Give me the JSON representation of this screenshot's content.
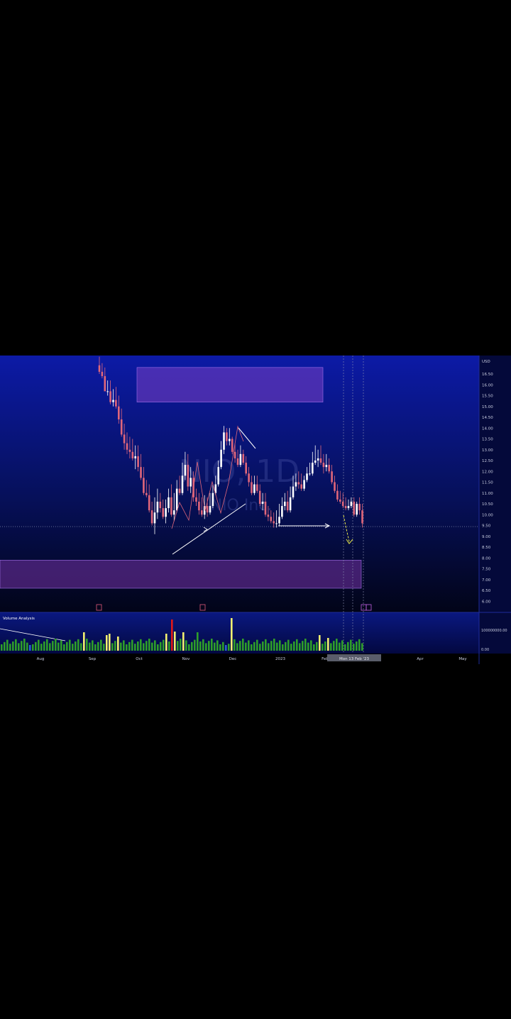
{
  "watermark": {
    "symbol": "NIO, 1D",
    "company": "NIO Inc."
  },
  "colors": {
    "bull": "#ffffff",
    "bear": "#e0667a",
    "zone": "#7b3fc4",
    "vol_green": "#2e9e2a",
    "vol_yellow": "#f3f070",
    "vol_red": "#e01818",
    "vol_blue": "#2a62d6",
    "annotation": "#ffffff",
    "projection": "#e8e84a"
  },
  "price_axis": {
    "currency": "USD",
    "ticks": [
      "16.50",
      "16.00",
      "15.50",
      "15.00",
      "14.50",
      "14.00",
      "13.50",
      "13.00",
      "12.50",
      "12.00",
      "11.50",
      "11.00",
      "10.50",
      "10.00",
      "9.50",
      "9.00",
      "8.50",
      "8.00",
      "7.50",
      "7.00",
      "6.50",
      "6.00"
    ]
  },
  "volume_axis": {
    "ticks": [
      "100000000.00",
      "0.00"
    ]
  },
  "volume_pane": {
    "title": "Volume Analysis"
  },
  "time_axis": {
    "labels": [
      "Aug",
      "Sep",
      "Oct",
      "Nov",
      "Dec",
      "2023",
      "Feb",
      "Apr",
      "May"
    ]
  },
  "crosshair_label": "Mon 13 Feb '23",
  "chart_data": {
    "type": "candlestick",
    "title": "NIO, 1D",
    "ylim": [
      6.0,
      17.0
    ],
    "dates": [
      "2022-09-27",
      "2022-09-28",
      "2022-09-29",
      "2022-09-30",
      "2022-10-03",
      "2022-10-04",
      "2022-10-05",
      "2022-10-06",
      "2022-10-07",
      "2022-10-10",
      "2022-10-11",
      "2022-10-12",
      "2022-10-13",
      "2022-10-14",
      "2022-10-17",
      "2022-10-18",
      "2022-10-19",
      "2022-10-20",
      "2022-10-21",
      "2022-10-24",
      "2022-10-25",
      "2022-10-26",
      "2022-10-27",
      "2022-10-28",
      "2022-10-31",
      "2022-11-01",
      "2022-11-02",
      "2022-11-03",
      "2022-11-04",
      "2022-11-07",
      "2022-11-08",
      "2022-11-09",
      "2022-11-10",
      "2022-11-11",
      "2022-11-14",
      "2022-11-15",
      "2022-11-16",
      "2022-11-17",
      "2022-11-18",
      "2022-11-21",
      "2022-11-22",
      "2022-11-23",
      "2022-11-25",
      "2022-11-28",
      "2022-11-29",
      "2022-11-30",
      "2022-12-01",
      "2022-12-02",
      "2022-12-05",
      "2022-12-06",
      "2022-12-07",
      "2022-12-08",
      "2022-12-09",
      "2022-12-12",
      "2022-12-13",
      "2022-12-14",
      "2022-12-15",
      "2022-12-16",
      "2022-12-19",
      "2022-12-20",
      "2022-12-21",
      "2022-12-22",
      "2022-12-23",
      "2022-12-27",
      "2022-12-28",
      "2022-12-29",
      "2022-12-30",
      "2023-01-03",
      "2023-01-04",
      "2023-01-05",
      "2023-01-06",
      "2023-01-09",
      "2023-01-10",
      "2023-01-11",
      "2023-01-12",
      "2023-01-13",
      "2023-01-17",
      "2023-01-18",
      "2023-01-19",
      "2023-01-20",
      "2023-01-23",
      "2023-01-24",
      "2023-01-25",
      "2023-01-26",
      "2023-01-27",
      "2023-01-30",
      "2023-01-31",
      "2023-02-01",
      "2023-02-02",
      "2023-02-03",
      "2023-02-06",
      "2023-02-07",
      "2023-02-08",
      "2023-02-09",
      "2023-02-10",
      "2023-02-13"
    ],
    "open": [
      16.9,
      16.6,
      16.4,
      15.7,
      15.7,
      15.2,
      15.3,
      15.0,
      14.4,
      13.7,
      13.3,
      13.0,
      12.9,
      12.6,
      12.7,
      12.2,
      11.7,
      11.0,
      10.9,
      10.2,
      9.6,
      10.1,
      10.6,
      10.3,
      9.9,
      10.3,
      10.8,
      10.0,
      10.2,
      11.2,
      11.0,
      11.8,
      12.3,
      11.3,
      11.7,
      10.8,
      10.6,
      10.2,
      10.0,
      10.4,
      10.1,
      10.4,
      11.0,
      11.4,
      12.2,
      13.0,
      13.8,
      13.4,
      13.5,
      12.9,
      12.6,
      12.3,
      12.8,
      12.4,
      11.9,
      11.5,
      11.0,
      11.4,
      11.1,
      10.5,
      10.6,
      10.0,
      9.9,
      9.7,
      9.6,
      9.6,
      9.9,
      10.4,
      10.6,
      10.2,
      10.8,
      11.3,
      11.5,
      11.4,
      11.2,
      11.6,
      11.9,
      11.9,
      12.4,
      12.5,
      12.6,
      12.4,
      12.2,
      12.3,
      12.0,
      11.5,
      11.1,
      10.7,
      10.6,
      10.4,
      10.3,
      10.4,
      10.6,
      10.0,
      10.5,
      10.2
    ],
    "high": [
      17.3,
      17.0,
      16.8,
      16.2,
      16.2,
      15.8,
      15.9,
      15.5,
      14.9,
      14.2,
      13.8,
      13.6,
      13.5,
      13.2,
      13.2,
      12.8,
      12.2,
      11.6,
      11.4,
      10.6,
      10.8,
      11.2,
      11.0,
      10.7,
      10.7,
      11.2,
      11.4,
      11.0,
      11.6,
      11.8,
      12.4,
      12.9,
      12.8,
      12.2,
      12.0,
      11.2,
      11.0,
      10.8,
      10.9,
      10.8,
      11.0,
      11.4,
      11.8,
      12.5,
      13.4,
      14.1,
      14.0,
      14.0,
      13.6,
      13.3,
      13.0,
      13.2,
      13.0,
      12.7,
      12.2,
      11.8,
      11.8,
      11.8,
      11.4,
      11.0,
      11.0,
      10.4,
      10.2,
      10.1,
      10.2,
      10.5,
      10.8,
      11.0,
      11.1,
      11.3,
      11.8,
      11.9,
      12.0,
      11.9,
      11.8,
      12.2,
      12.4,
      12.9,
      13.2,
      13.0,
      13.2,
      12.8,
      12.8,
      12.6,
      12.3,
      11.8,
      11.4,
      11.1,
      11.0,
      10.8,
      10.7,
      10.8,
      10.8,
      10.6,
      10.8,
      10.5
    ],
    "low": [
      16.5,
      16.3,
      16.0,
      15.5,
      15.1,
      15.0,
      14.9,
      14.2,
      13.6,
      13.0,
      12.8,
      12.6,
      12.5,
      12.1,
      12.0,
      11.6,
      10.9,
      10.8,
      10.1,
      9.5,
      9.1,
      9.8,
      10.1,
      9.8,
      9.6,
      10.1,
      9.9,
      9.7,
      10.1,
      10.9,
      10.9,
      11.6,
      11.1,
      11.0,
      10.6,
      10.4,
      10.0,
      9.9,
      9.8,
      9.9,
      10.0,
      10.3,
      10.9,
      11.3,
      12.1,
      12.8,
      13.2,
      13.2,
      12.8,
      12.4,
      12.2,
      12.2,
      12.3,
      11.8,
      11.3,
      10.9,
      10.9,
      11.0,
      10.4,
      10.2,
      9.9,
      9.7,
      9.6,
      9.4,
      9.4,
      9.5,
      9.8,
      10.2,
      10.1,
      10.1,
      10.7,
      11.1,
      11.2,
      11.1,
      11.1,
      11.5,
      11.8,
      11.8,
      12.3,
      12.2,
      12.3,
      11.9,
      12.0,
      11.9,
      11.4,
      11.0,
      10.6,
      10.5,
      10.3,
      10.2,
      10.2,
      10.3,
      9.9,
      9.9,
      10.0,
      9.4
    ],
    "close": [
      16.6,
      16.4,
      15.7,
      15.7,
      15.2,
      15.3,
      15.0,
      14.4,
      13.7,
      13.3,
      13.0,
      12.9,
      12.6,
      12.7,
      12.2,
      11.7,
      11.0,
      10.9,
      10.2,
      9.6,
      10.1,
      10.6,
      10.3,
      9.9,
      10.3,
      10.8,
      10.0,
      10.2,
      11.2,
      11.0,
      11.8,
      12.3,
      11.3,
      11.7,
      10.8,
      10.6,
      10.2,
      10.0,
      10.4,
      10.1,
      10.4,
      11.0,
      11.4,
      12.2,
      13.0,
      13.8,
      13.4,
      13.5,
      12.9,
      12.6,
      12.3,
      12.8,
      12.4,
      11.9,
      11.5,
      11.0,
      11.4,
      11.1,
      10.5,
      10.6,
      10.0,
      9.9,
      9.7,
      9.6,
      9.6,
      9.9,
      10.4,
      10.6,
      10.2,
      10.8,
      11.3,
      11.5,
      11.4,
      11.2,
      11.6,
      11.9,
      11.9,
      12.4,
      12.5,
      12.6,
      12.4,
      12.2,
      12.3,
      12.0,
      11.5,
      11.1,
      10.7,
      10.6,
      10.4,
      10.3,
      10.4,
      10.6,
      10.0,
      10.5,
      10.2,
      9.6
    ],
    "volume_shown": "relative bars, green = normal, yellow = elevated, red = extreme, blue = low",
    "zones": [
      {
        "name": "supply",
        "from": 15.2,
        "to": 16.8
      },
      {
        "name": "demand",
        "from": 6.6,
        "to": 7.9
      }
    ],
    "current_price": 9.45
  }
}
